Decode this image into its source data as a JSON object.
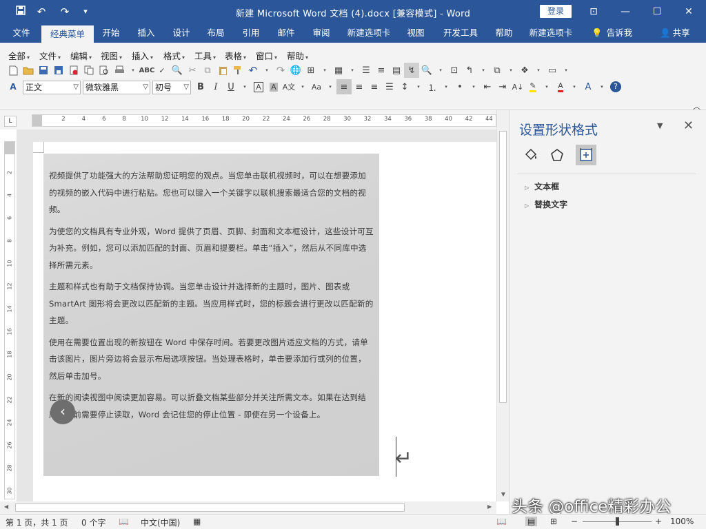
{
  "titlebar": {
    "title": "新建 Microsoft Word 文档 (4).docx [兼容模式]  -  Word",
    "login": "登录",
    "save_glyph": "💾",
    "undo_glyph": "↶",
    "redo_glyph": "↷",
    "customize_glyph": "▾",
    "ribbon_display_glyph": "⊡",
    "minimize_glyph": "—",
    "maximize_glyph": "☐",
    "close_glyph": "✕"
  },
  "tabs": {
    "items": [
      "文件",
      "经典菜单",
      "开始",
      "插入",
      "设计",
      "布局",
      "引用",
      "邮件",
      "审阅",
      "新建选项卡",
      "视图",
      "开发工具",
      "帮助",
      "新建选项卡"
    ],
    "active_index": 1,
    "tell_me": "告诉我",
    "share": "共享"
  },
  "menus": [
    "全部",
    "文件",
    "编辑",
    "视图",
    "插入",
    "格式",
    "工具",
    "表格",
    "窗口",
    "帮助"
  ],
  "format": {
    "style": "正文",
    "font": "微软雅黑",
    "size": "初号"
  },
  "ruler": {
    "h_ticks": [
      "2",
      "4",
      "6",
      "8",
      "10",
      "12",
      "14",
      "16",
      "18",
      "20",
      "22",
      "24",
      "26",
      "28",
      "30",
      "32",
      "34",
      "36",
      "38",
      "40",
      "42",
      "44"
    ],
    "v_ticks": [
      "2",
      "4",
      "6",
      "8",
      "10",
      "12",
      "14",
      "16",
      "18",
      "20",
      "22",
      "24",
      "26",
      "28",
      "30"
    ]
  },
  "document": {
    "paragraphs": [
      "视频提供了功能强大的方法帮助您证明您的观点。当您单击联机视频时，可以在想要添加的视频的嵌入代码中进行粘贴。您也可以键入一个关键字以联机搜索最适合您的文档的视频。",
      "为使您的文档具有专业外观，Word 提供了页眉、页脚、封面和文本框设计，这些设计可互为补充。例如，您可以添加匹配的封面、页眉和提要栏。单击“插入”，然后从不同库中选择所需元素。",
      "主题和样式也有助于文档保持协调。当您单击设计并选择新的主题时，图片、图表或 SmartArt 图形将会更改以匹配新的主题。当应用样式时，您的标题会进行更改以匹配新的主题。",
      "使用在需要位置出现的新按钮在 Word 中保存时间。若要更改图片适应文档的方式，请单击该图片，图片旁边将会显示布局选项按钮。当处理表格时，单击要添加行或列的位置，然后单击加号。",
      "在新的阅读视图中阅读更加容易。可以折叠文档某些部分并关注所需文本。如果在达到结尾处之前需要停止读取，Word 会记住您的停止位置 - 即使在另一个设备上。"
    ],
    "prev_glyph": "‹",
    "return_glyph": "↵"
  },
  "pane": {
    "title": "设置形状格式",
    "sections": [
      "文本框",
      "替换文字"
    ],
    "icons": [
      "fill-line-icon",
      "effects-icon",
      "layout-properties-icon"
    ]
  },
  "status": {
    "page": "第 1 页，共 1 页",
    "words": "0 个字",
    "lang": "中文(中国)",
    "zoom": "100%",
    "zoom_minus": "−",
    "zoom_plus": "+"
  },
  "watermark": "头条 @office精彩办公"
}
